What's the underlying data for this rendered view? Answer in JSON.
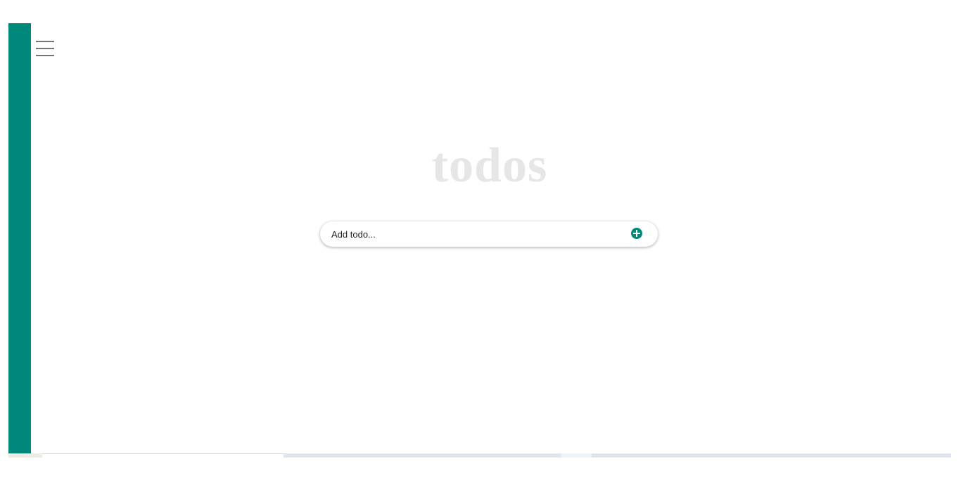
{
  "theme": {
    "accent_color": "#00897b"
  },
  "header": {
    "menu_icon": "hamburger-menu-icon"
  },
  "app": {
    "title": "todos"
  },
  "add_todo": {
    "placeholder": "Add todo...",
    "value": "",
    "add_icon": "plus-circle-icon"
  }
}
